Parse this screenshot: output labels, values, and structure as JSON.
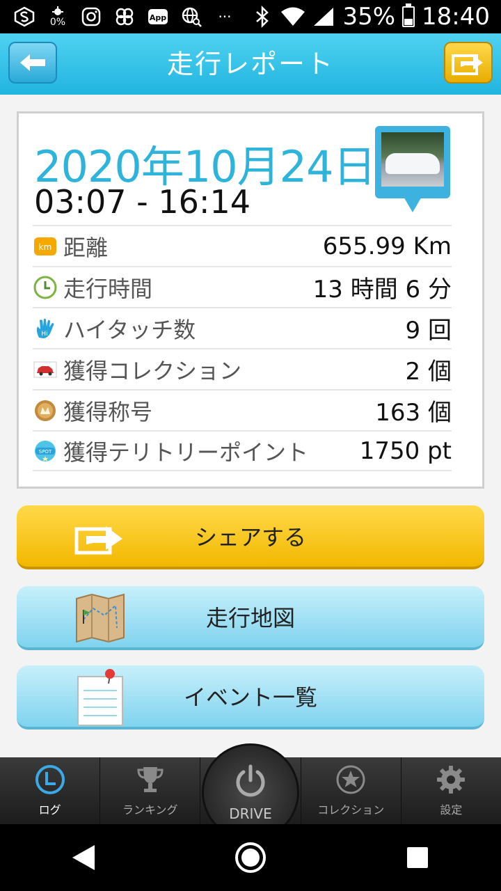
{
  "status_bar": {
    "percent_label": "0%",
    "app_label": "App",
    "dots": "···",
    "battery": "35%",
    "battery_level": 0.35,
    "time": "18:40"
  },
  "header": {
    "title": "走行レポート"
  },
  "report": {
    "date": "2020年10月24日",
    "time_range": "03:07 - 16:14",
    "rows": [
      {
        "label": "距離",
        "value": "655.99 Km",
        "icon": "km-icon"
      },
      {
        "label": "走行時間",
        "value": "13 時間 6 分",
        "icon": "clock-icon"
      },
      {
        "label": "ハイタッチ数",
        "value": "9 回",
        "icon": "hand-icon"
      },
      {
        "label": "獲得コレクション",
        "value": "2 個",
        "icon": "car-icon"
      },
      {
        "label": "獲得称号",
        "value": "163 個",
        "icon": "medal-icon"
      },
      {
        "label": "獲得テリトリーポイント",
        "value": "1750 pt",
        "icon": "spot-icon"
      }
    ],
    "row_icon_text": {
      "km": "km",
      "hi": "Hi",
      "spot": "SPOT"
    }
  },
  "buttons": {
    "share": "シェアする",
    "map": "走行地図",
    "events": "イベント一覧"
  },
  "tabs": {
    "log": "ログ",
    "ranking": "ランキング",
    "drive": "DRIVE",
    "collection": "コレクション",
    "settings": "設定"
  },
  "colors": {
    "header": "#21b4e0",
    "date": "#2eb3da",
    "share_button": "#f2b800",
    "light_button": "#7fd3ee"
  }
}
